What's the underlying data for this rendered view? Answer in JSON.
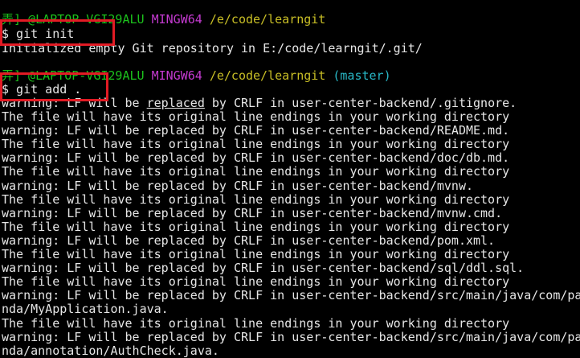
{
  "prompt1": {
    "user": "弄] @LAPTOP-VGI29ALU",
    "env": "MINGW64",
    "path": "/e/code/learngit",
    "branch": ""
  },
  "cmd1": "$ git init",
  "out1": "Initialized empty Git repository in E:/code/learngit/.git/",
  "prompt2": {
    "user": "弄] @LAPTOP-VGI29ALU",
    "env": "MINGW64",
    "path": "/e/code/learngit",
    "branch": "(master)"
  },
  "cmd2": "$ git add .",
  "warn_first": {
    "pre": "warning: LF will be ",
    "word": "replaced",
    "post": " by CRLF in user-center-backend/.gitignore."
  },
  "lines": [
    "The file will have its original line endings in your working directory",
    "warning: LF will be replaced by CRLF in user-center-backend/README.md.",
    "The file will have its original line endings in your working directory",
    "warning: LF will be replaced by CRLF in user-center-backend/doc/db.md.",
    "The file will have its original line endings in your working directory",
    "warning: LF will be replaced by CRLF in user-center-backend/mvnw.",
    "The file will have its original line endings in your working directory",
    "warning: LF will be replaced by CRLF in user-center-backend/mvnw.cmd.",
    "The file will have its original line endings in your working directory",
    "warning: LF will be replaced by CRLF in user-center-backend/pom.xml.",
    "The file will have its original line endings in your working directory",
    "warning: LF will be replaced by CRLF in user-center-backend/sql/ddl.sql.",
    "The file will have its original line endings in your working directory",
    "warning: LF will be replaced by CRLF in user-center-backend/src/main/java/com/pa",
    "nda/MyApplication.java.",
    "The file will have its original line endings in your working directory",
    "warning: LF will be replaced by CRLF in user-center-backend/src/main/java/com/pa",
    "nda/annotation/AuthCheck.java."
  ]
}
